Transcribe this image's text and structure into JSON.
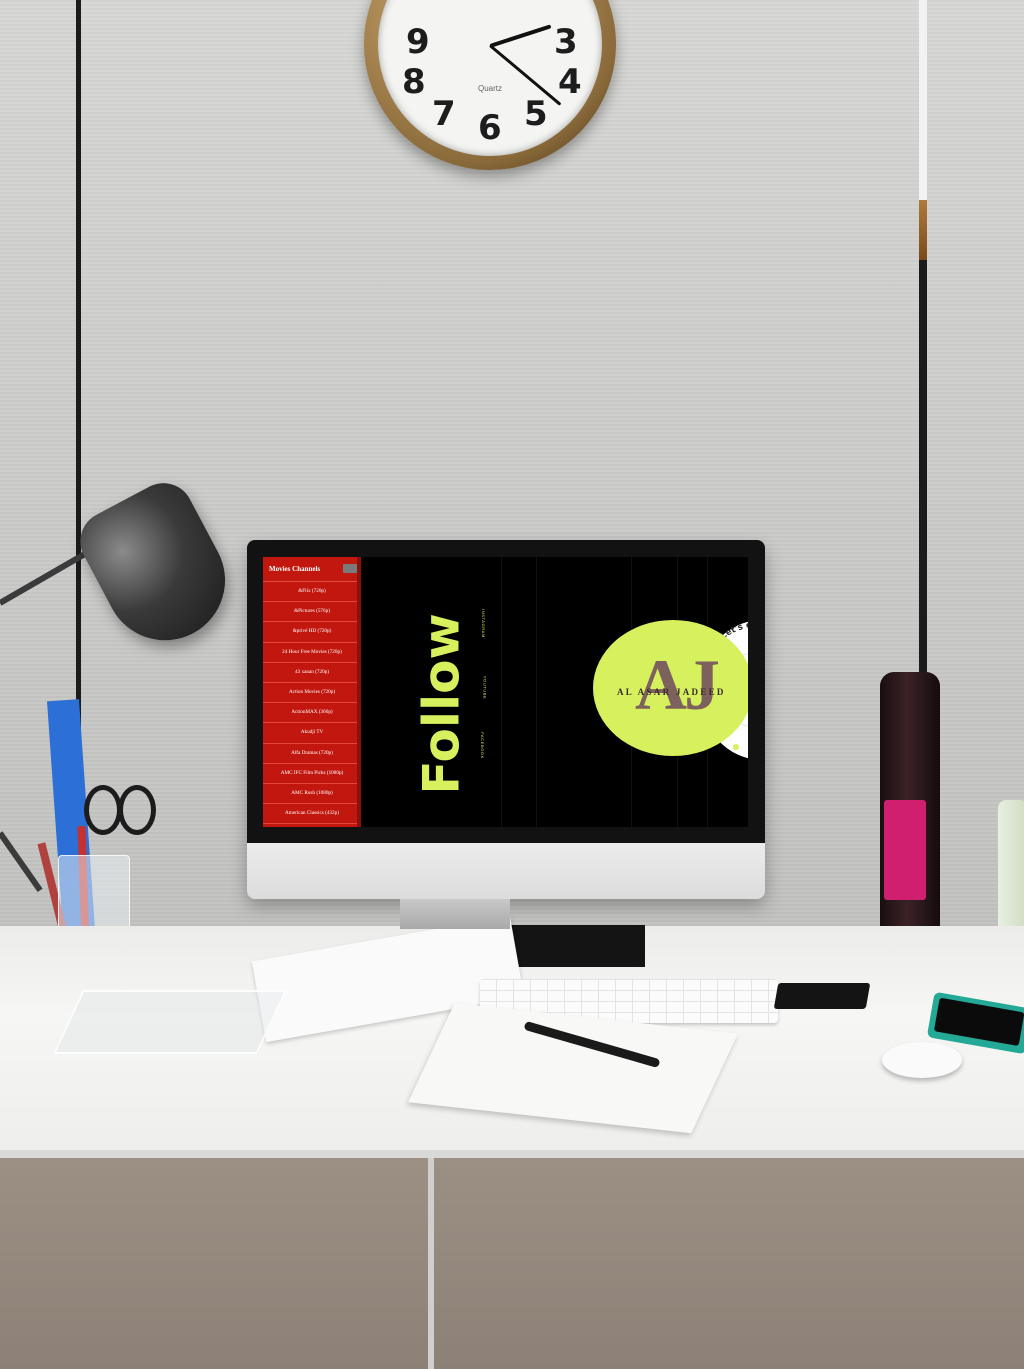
{
  "clock": {
    "numbers": [
      "9",
      "3",
      "8",
      "4",
      "7",
      "6",
      "5"
    ],
    "brand": "Quartz"
  },
  "sidebar": {
    "title": "Movies Channels",
    "items": [
      {
        "label": "&Flix (720p)"
      },
      {
        "label": "&Pictures (576p)"
      },
      {
        "label": "&privé HD (720p)"
      },
      {
        "label": "24 Hour Free Movies (720p)"
      },
      {
        "label": "43 xanan (720p)"
      },
      {
        "label": "Action Movies (720p)"
      },
      {
        "label": "ActionMAX (360p)"
      },
      {
        "label": "Akudji TV"
      },
      {
        "label": "Alfa Dramas (720p)"
      },
      {
        "label": "AMC IFC Film Picks (1080p)"
      },
      {
        "label": "AMC Rush (1080p)"
      },
      {
        "label": "American Classics (432p)"
      }
    ]
  },
  "main": {
    "heading": "Follow",
    "social_links": [
      "INSTAGRAM",
      "YOUTUBE",
      "FACEBOOK"
    ],
    "logo_letters": "AJ",
    "logo_name": "AL ASAR JADEED",
    "circular_text": "Let's create something great",
    "icons": [
      "link-icon",
      "spotify-icon",
      "profile-icon"
    ]
  },
  "colors": {
    "sidebar_bg": "#c1170f",
    "accent": "#d6f05e",
    "screen_bg": "#000000"
  }
}
